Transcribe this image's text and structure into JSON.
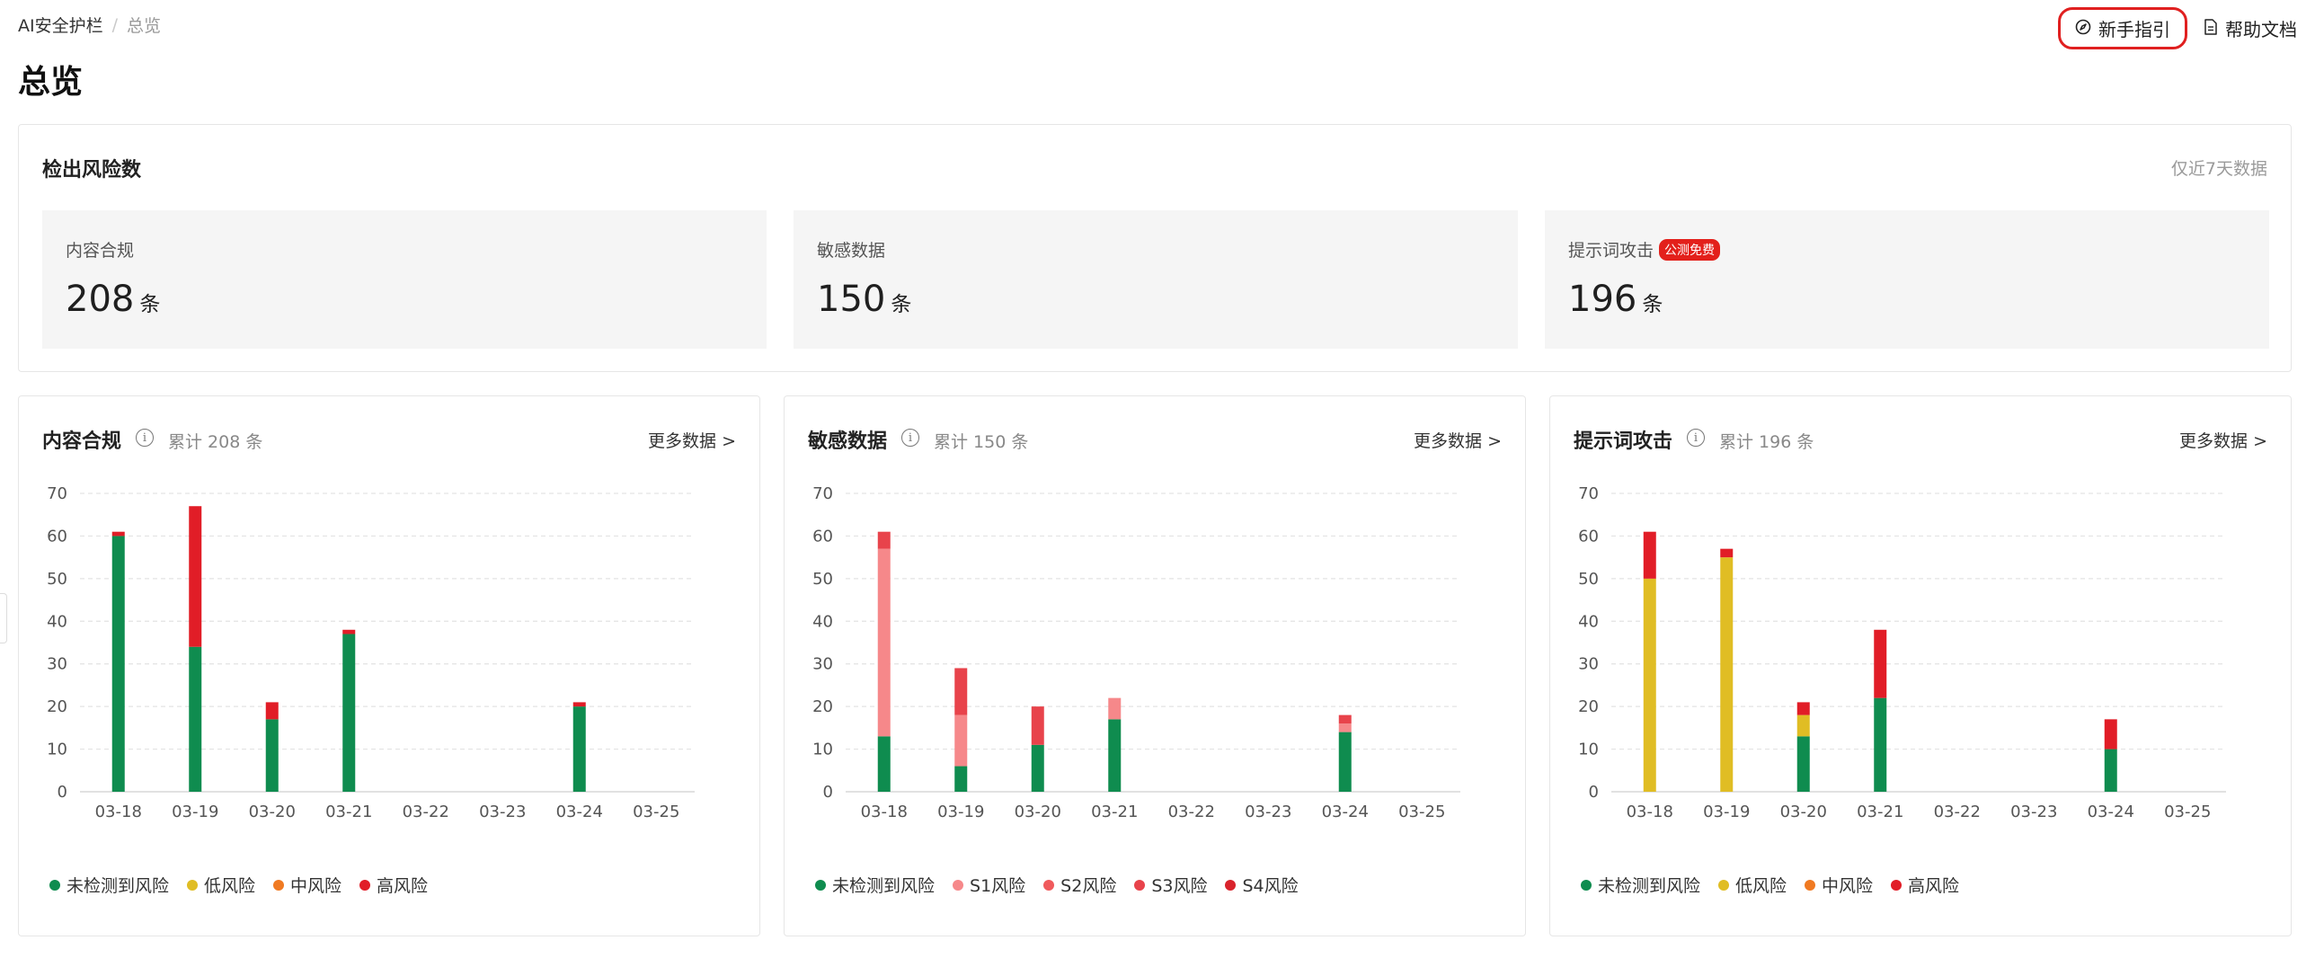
{
  "breadcrumb": {
    "root": "AI安全护栏",
    "separator": "/",
    "current": "总览"
  },
  "page_title": "总览",
  "actions": {
    "guide_label": "新手指引",
    "guide_icon": "compass-icon",
    "docs_label": "帮助文档",
    "docs_icon": "document-icon"
  },
  "summary": {
    "title": "检出风险数",
    "note": "仅近7天数据",
    "stats": [
      {
        "label": "内容合规",
        "value": "208",
        "unit": "条"
      },
      {
        "label": "敏感数据",
        "value": "150",
        "unit": "条"
      },
      {
        "label": "提示词攻击",
        "value": "196",
        "unit": "条",
        "badge": "公测免费"
      }
    ]
  },
  "charts": [
    {
      "title": "内容合规",
      "total": "累计 208 条",
      "more": "更多数据 >"
    },
    {
      "title": "敏感数据",
      "total": "累计 150 条",
      "more": "更多数据 >"
    },
    {
      "title": "提示词攻击",
      "total": "累计 196 条",
      "more": "更多数据 >"
    }
  ],
  "chart_data": [
    {
      "type": "bar",
      "stacked": true,
      "title": "内容合规",
      "categories": [
        "03-18",
        "03-19",
        "03-20",
        "03-21",
        "03-22",
        "03-23",
        "03-24",
        "03-25"
      ],
      "ylim": [
        0,
        70
      ],
      "yticks": [
        0,
        10,
        20,
        30,
        40,
        50,
        60,
        70
      ],
      "grid": true,
      "legend_position": "bottom-left",
      "series": [
        {
          "name": "未检测到风险",
          "color": "#0f8c4f",
          "values": [
            60,
            34,
            17,
            37,
            0,
            0,
            20,
            0
          ]
        },
        {
          "name": "低风险",
          "color": "#e0bd24",
          "values": [
            0,
            0,
            0,
            0,
            0,
            0,
            0,
            0
          ]
        },
        {
          "name": "中风险",
          "color": "#f07a22",
          "values": [
            0,
            0,
            0,
            0,
            0,
            0,
            0,
            0
          ]
        },
        {
          "name": "高风险",
          "color": "#e11d27",
          "values": [
            1,
            33,
            4,
            1,
            0,
            0,
            1,
            0
          ]
        }
      ]
    },
    {
      "type": "bar",
      "stacked": true,
      "title": "敏感数据",
      "categories": [
        "03-18",
        "03-19",
        "03-20",
        "03-21",
        "03-22",
        "03-23",
        "03-24",
        "03-25"
      ],
      "ylim": [
        0,
        70
      ],
      "yticks": [
        0,
        10,
        20,
        30,
        40,
        50,
        60,
        70
      ],
      "grid": true,
      "legend_position": "bottom-left",
      "series": [
        {
          "name": "未检测到风险",
          "color": "#0f8c4f",
          "values": [
            13,
            6,
            11,
            17,
            0,
            0,
            14,
            0
          ]
        },
        {
          "name": "S1风险",
          "color": "#f6888a",
          "values": [
            44,
            12,
            0,
            5,
            0,
            0,
            2,
            0
          ]
        },
        {
          "name": "S2风险",
          "color": "#f05a5c",
          "values": [
            0,
            0,
            0,
            0,
            0,
            0,
            0,
            0
          ]
        },
        {
          "name": "S3风险",
          "color": "#e8434b",
          "values": [
            4,
            11,
            9,
            0,
            0,
            0,
            2,
            0
          ]
        },
        {
          "name": "S4风险",
          "color": "#d9232c",
          "values": [
            0,
            0,
            0,
            0,
            0,
            0,
            0,
            0
          ]
        }
      ]
    },
    {
      "type": "bar",
      "stacked": true,
      "title": "提示词攻击",
      "categories": [
        "03-18",
        "03-19",
        "03-20",
        "03-21",
        "03-22",
        "03-23",
        "03-24",
        "03-25"
      ],
      "ylim": [
        0,
        70
      ],
      "yticks": [
        0,
        10,
        20,
        30,
        40,
        50,
        60,
        70
      ],
      "grid": true,
      "legend_position": "bottom-left",
      "series": [
        {
          "name": "未检测到风险",
          "color": "#0f8c4f",
          "values": [
            0,
            0,
            13,
            22,
            0,
            0,
            10,
            0
          ]
        },
        {
          "name": "低风险",
          "color": "#e0bd24",
          "values": [
            50,
            55,
            5,
            0,
            0,
            0,
            0,
            0
          ]
        },
        {
          "name": "中风险",
          "color": "#f07a22",
          "values": [
            0,
            0,
            0,
            0,
            0,
            0,
            0,
            0
          ]
        },
        {
          "name": "高风险",
          "color": "#e11d27",
          "values": [
            11,
            2,
            3,
            16,
            0,
            0,
            7,
            0
          ]
        }
      ]
    }
  ]
}
